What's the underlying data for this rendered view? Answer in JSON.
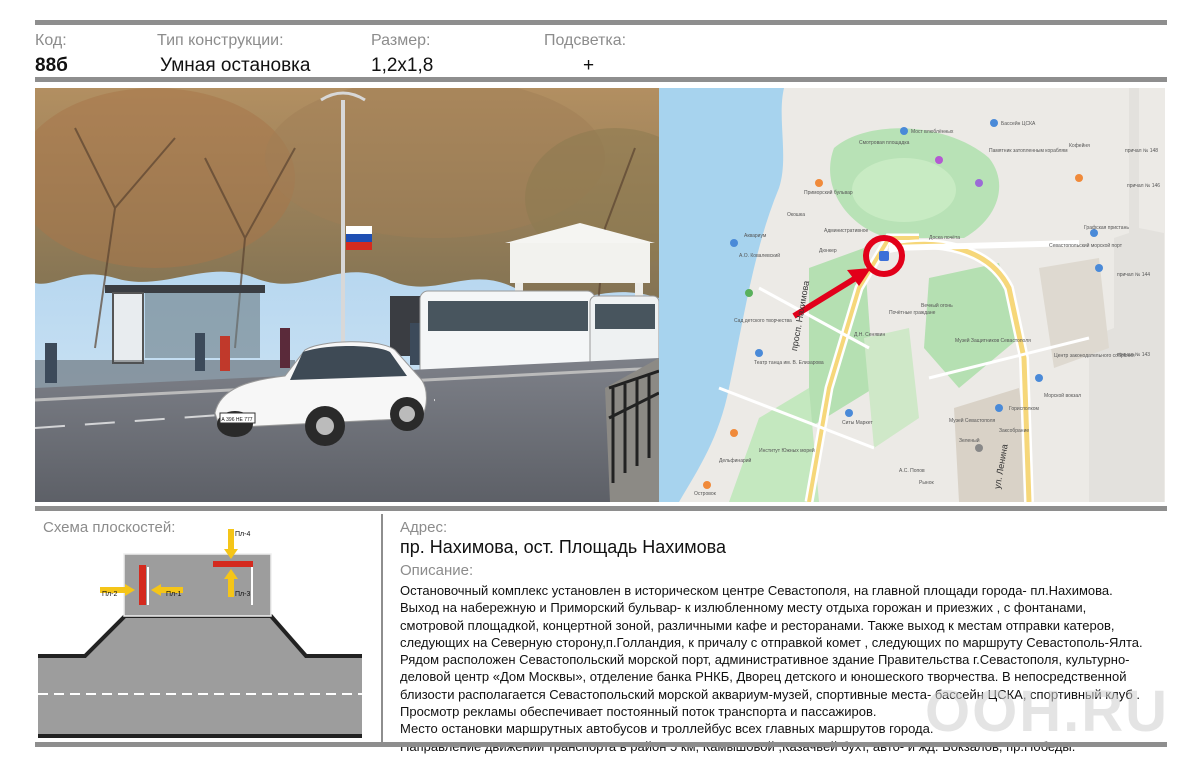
{
  "header": {
    "code_label": "Код:",
    "type_label": "Тип конструкции:",
    "size_label": "Размер:",
    "light_label": "Подсветка:",
    "code_value": "88б",
    "type_value": "Умная остановка",
    "size_value": "1,2х1,8",
    "light_value": "+"
  },
  "map": {
    "street_nakhimova": "просп. Нахимова",
    "street_lenina": "ул. Ленина",
    "labels": [
      "Мост влюблённых",
      "Бассейн ЦСКА",
      "Смотровая площадка",
      "Приморский бульвар",
      "Окошка",
      "Аквариум",
      "Административное",
      "Дюнкер",
      "Доска почёта",
      "Памятник затопленным кораблям",
      "Графская пристань",
      "Севастопольский морской порт",
      "причал № 144",
      "причал № 148",
      "причал № 146",
      "причал № 143",
      "Кофейня",
      "А.О. Ковалевский",
      "Театр танца им. В. Елизарова",
      "Сад детского творчества",
      "Почётные граждане",
      "Д.Н. Сенявин",
      "Вечный огонь",
      "Музей Защитников Севастополя",
      "Морской вокзал",
      "Центр законодательного собрания",
      "Ситы Маркет",
      "Дельфинарий",
      "Островок",
      "Институт Южных морей",
      "Рынок",
      "А.С. Попов",
      "Зеленый",
      "Горисполком",
      "Заксобрание",
      "Музей Севастополя"
    ]
  },
  "schema": {
    "title": "Схема плоскостей:",
    "planes": [
      "Пл-1",
      "Пл-2",
      "Пл-3",
      "Пл-4"
    ]
  },
  "info": {
    "address_label": "Адрес:",
    "address_value": "пр. Нахимова, ост. Площадь Нахимова",
    "description_label": "Описание:",
    "description_lines": [
      "Остановочный комплекс установлен в историческом центре Севастополя, на главной площади города- пл.Нахимова.",
      "Выход на набережную и Приморский бульвар- к излюбленному месту отдыха горожан и приезжих , с фонтанами,",
      "смотровой площадкой, концертной зоной, различными кафе и ресторанами. Также выход к местам отправки катеров,",
      "следующих на Северную сторону,п.Голландия, к причалу с отправкой комет , следующих по маршруту Севастополь-Ялта.",
      "Рядом расположен Севастопольский морской порт, административное здание Правительства г.Севастополя, культурно-",
      "деловой центр «Дом Москвы», отделение банка РНКБ, Дворец детского и юношеского творчества. В непосредственной",
      "близости располагается Севастопольский морской аквариум-музей, спортивные места- бассейн ЦСКА, спортивный клуб .",
      "Просмотр рекламы обеспечивает постоянный поток транспорта и пассажиров.",
      "Место остановки маршрутных автобусов и троллейбус всех главных маршрутов города.",
      "Направление движении транспорта в район 5 км, Камышовой ,Казачьей бухт, авто- и жд. Вокзалов, пр.Победы."
    ]
  },
  "photo": {
    "plate": "А 396 НЕ 777"
  },
  "watermark": "OOH.RU",
  "colors": {
    "bar": "#8e8e8e",
    "label": "#8c8c8c",
    "plane_red": "#d42a1e",
    "arrow_yellow": "#f5c518",
    "marker_red": "#e2001a"
  }
}
